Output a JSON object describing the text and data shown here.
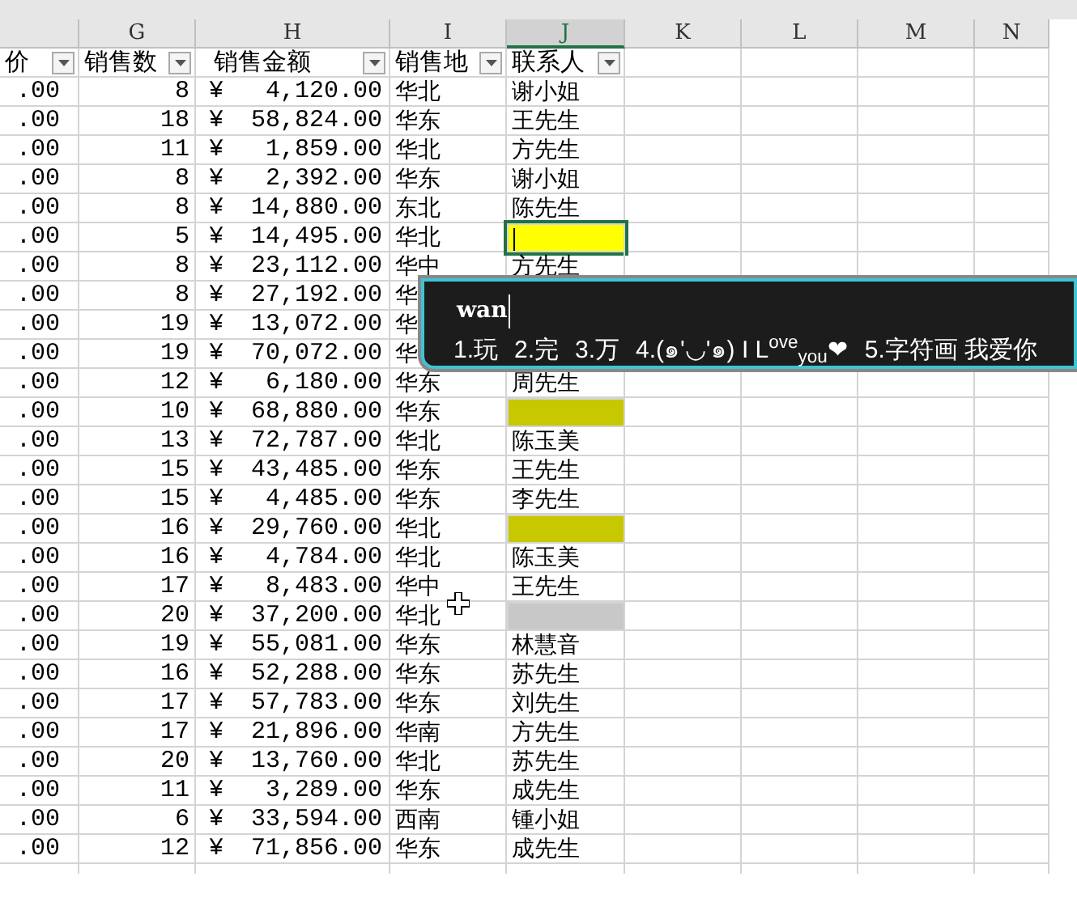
{
  "column_letters": [
    {
      "label": "G",
      "selected": false
    },
    {
      "label": "H",
      "selected": false
    },
    {
      "label": "I",
      "selected": false
    },
    {
      "label": "J",
      "selected": true
    },
    {
      "label": "K",
      "selected": false
    },
    {
      "label": "L",
      "selected": false
    },
    {
      "label": "M",
      "selected": false
    },
    {
      "label": "N",
      "selected": false
    }
  ],
  "headers": [
    "价",
    "销售数",
    "销售金额",
    "销售地",
    "联系人"
  ],
  "currency": "¥",
  "rows": [
    {
      "price": ".00",
      "qty": "8",
      "amount": "4,120.00",
      "region": "华北",
      "contact": "谢小姐",
      "editing": false
    },
    {
      "price": ".00",
      "qty": "18",
      "amount": "58,824.00",
      "region": "华东",
      "contact": "王先生",
      "editing": false
    },
    {
      "price": ".00",
      "qty": "11",
      "amount": "1,859.00",
      "region": "华北",
      "contact": "方先生",
      "editing": false
    },
    {
      "price": ".00",
      "qty": "8",
      "amount": "2,392.00",
      "region": "华东",
      "contact": "谢小姐",
      "editing": false
    },
    {
      "price": ".00",
      "qty": "8",
      "amount": "14,880.00",
      "region": "东北",
      "contact": "陈先生",
      "editing": false
    },
    {
      "price": ".00",
      "qty": "5",
      "amount": "14,495.00",
      "region": "华北",
      "contact": "",
      "color": "#ffff00",
      "editing": true
    },
    {
      "price": ".00",
      "qty": "8",
      "amount": "23,112.00",
      "region": "华中",
      "contact": "方先生",
      "editing": false
    },
    {
      "price": ".00",
      "qty": "8",
      "amount": "27,192.00",
      "region": "华"
    },
    {
      "price": ".00",
      "qty": "19",
      "amount": "13,072.00",
      "region": "华"
    },
    {
      "price": ".00",
      "qty": "19",
      "amount": "70,072.00",
      "region": "华"
    },
    {
      "price": ".00",
      "qty": "12",
      "amount": "6,180.00",
      "region": "华东",
      "contact": "周先生",
      "editing": false
    },
    {
      "price": ".00",
      "qty": "10",
      "amount": "68,880.00",
      "region": "华东",
      "contact": "",
      "color": "#c8c800",
      "editing": false
    },
    {
      "price": ".00",
      "qty": "13",
      "amount": "72,787.00",
      "region": "华北",
      "contact": "陈玉美",
      "editing": false
    },
    {
      "price": ".00",
      "qty": "15",
      "amount": "43,485.00",
      "region": "华东",
      "contact": "王先生",
      "editing": false
    },
    {
      "price": ".00",
      "qty": "15",
      "amount": "4,485.00",
      "region": "华东",
      "contact": "李先生",
      "editing": false
    },
    {
      "price": ".00",
      "qty": "16",
      "amount": "29,760.00",
      "region": "华北",
      "contact": "",
      "color": "#c8c800",
      "editing": false
    },
    {
      "price": ".00",
      "qty": "16",
      "amount": "4,784.00",
      "region": "华北",
      "contact": "陈玉美",
      "editing": false
    },
    {
      "price": ".00",
      "qty": "17",
      "amount": "8,483.00",
      "region": "华中",
      "contact": "王先生",
      "editing": false
    },
    {
      "price": ".00",
      "qty": "20",
      "amount": "37,200.00",
      "region": "华北",
      "contact": "",
      "color": "#c8c8c8",
      "editing": false
    },
    {
      "price": ".00",
      "qty": "19",
      "amount": "55,081.00",
      "region": "华东",
      "contact": "林慧音",
      "editing": false
    },
    {
      "price": ".00",
      "qty": "16",
      "amount": "52,288.00",
      "region": "华东",
      "contact": "苏先生",
      "editing": false
    },
    {
      "price": ".00",
      "qty": "17",
      "amount": "57,783.00",
      "region": "华东",
      "contact": "刘先生",
      "editing": false
    },
    {
      "price": ".00",
      "qty": "17",
      "amount": "21,896.00",
      "region": "华南",
      "contact": "方先生",
      "editing": false
    },
    {
      "price": ".00",
      "qty": "20",
      "amount": "13,760.00",
      "region": "华北",
      "contact": "苏先生",
      "editing": false
    },
    {
      "price": ".00",
      "qty": "11",
      "amount": "3,289.00",
      "region": "华东",
      "contact": "成先生",
      "editing": false
    },
    {
      "price": ".00",
      "qty": "6",
      "amount": "33,594.00",
      "region": "西南",
      "contact": "锺小姐",
      "editing": false
    },
    {
      "price": ".00",
      "qty": "12",
      "amount": "71,856.00",
      "region": "华东",
      "contact": "成先生",
      "editing": false
    }
  ],
  "ime": {
    "composition": "wan",
    "candidates": [
      "1.玩",
      "2.完",
      "3.万",
      "4.(๑'◡'๑) I L$^{ove}$$_{you}$❤",
      "5.字符画 我爱你"
    ]
  }
}
